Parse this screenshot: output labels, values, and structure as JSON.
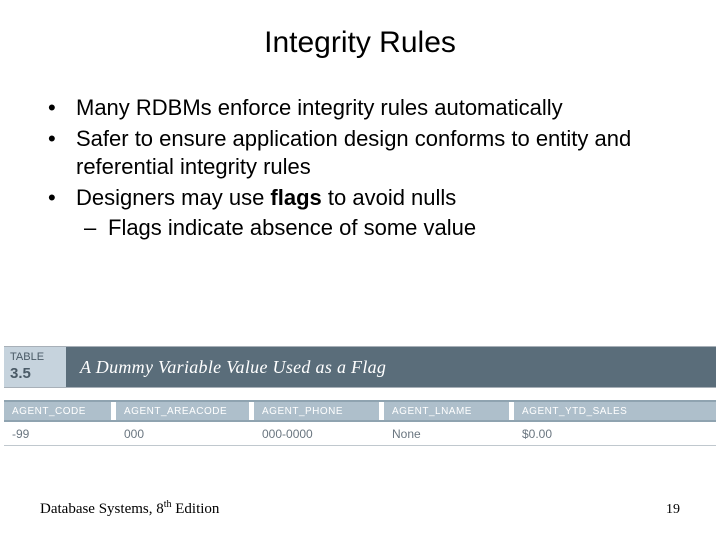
{
  "title": "Integrity Rules",
  "bullets": [
    {
      "level": 1,
      "text": "Many RDBMs enforce integrity rules automatically"
    },
    {
      "level": 1,
      "text": "Safer to ensure application design conforms to entity and referential integrity rules"
    },
    {
      "level": 1,
      "pre": "Designers may use ",
      "bold": "flags",
      "post": " to avoid nulls"
    },
    {
      "level": 2,
      "text": "Flags indicate absence of some value"
    }
  ],
  "table": {
    "label": "TABLE",
    "number": "3.5",
    "caption": "A Dummy Variable Value Used as a Flag",
    "columns": [
      "AGENT_CODE",
      "AGENT_AREACODE",
      "AGENT_PHONE",
      "AGENT_LNAME",
      "AGENT_YTD_SALES"
    ],
    "row": {
      "code": "-99",
      "areacode": "000",
      "phone": "000-0000",
      "lname": "None",
      "ytd": "$0.00"
    }
  },
  "footer": {
    "source_pre": "Database Systems, 8",
    "source_sup": "th",
    "source_post": " Edition",
    "page": "19"
  }
}
